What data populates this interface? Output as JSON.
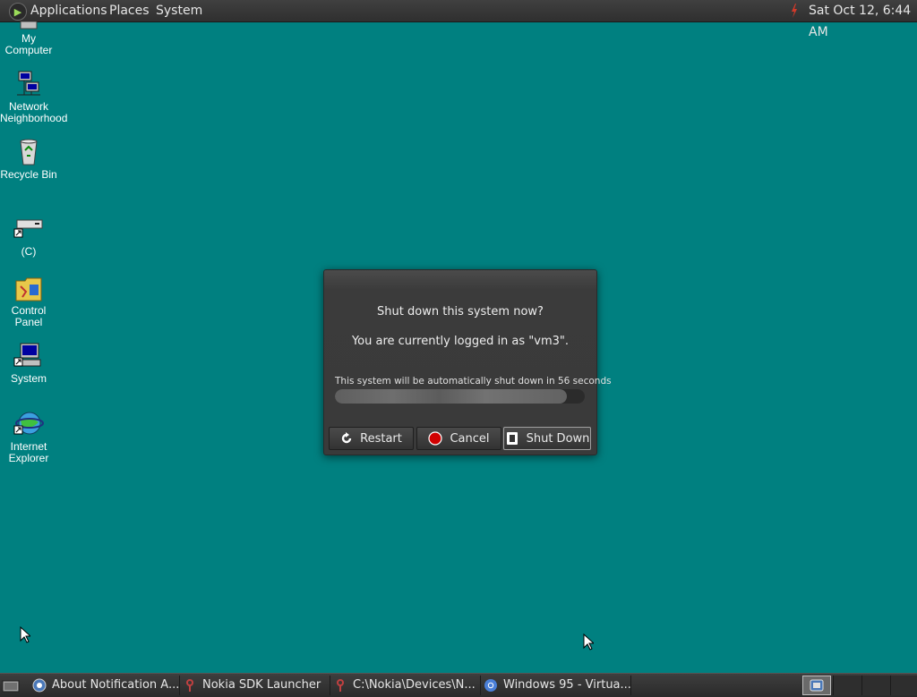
{
  "top_panel": {
    "menus": [
      "Applications",
      "Places",
      "System"
    ],
    "clock": "Sat Oct 12,  6:44 AM",
    "icons": {
      "logo": "app-menu-logo-icon",
      "tray": "flash-plugin-icon"
    }
  },
  "desktop": {
    "background_color": "#008080",
    "icons": [
      {
        "label": "My Computer",
        "icon": "my-computer-icon"
      },
      {
        "label": "Network\nNeighborhood",
        "icon": "network-neighborhood-icon"
      },
      {
        "label": "Recycle Bin",
        "icon": "recycle-bin-icon"
      },
      {
        "label": "(C)",
        "icon": "drive-c-icon"
      },
      {
        "label": "Control Panel",
        "icon": "control-panel-icon"
      },
      {
        "label": "System",
        "icon": "system-icon"
      },
      {
        "label": "Internet\nExplorer",
        "icon": "internet-explorer-icon"
      }
    ]
  },
  "dialog": {
    "title": "Shut down this system now?",
    "message": "You are currently logged in as \"vm3\".",
    "countdown": "This system will be automatically shut down in 56 seconds",
    "progress_fraction": 0.93,
    "buttons": {
      "restart": "Restart",
      "cancel": "Cancel",
      "shutdown": "Shut Down"
    },
    "colors": {
      "cancel_icon": "#d00000"
    }
  },
  "taskbar": {
    "tasks": [
      {
        "label": "About Notification A...",
        "icon": "notification-area-icon"
      },
      {
        "label": "Nokia SDK Launcher",
        "icon": "nokia-sdk-icon"
      },
      {
        "label": "C:\\Nokia\\Devices\\N...",
        "icon": "nokia-sdk-icon"
      },
      {
        "label": "Windows 95 - Virtua...",
        "icon": "chrome-icon"
      }
    ],
    "workspaces": 4,
    "active_workspace": 1
  }
}
